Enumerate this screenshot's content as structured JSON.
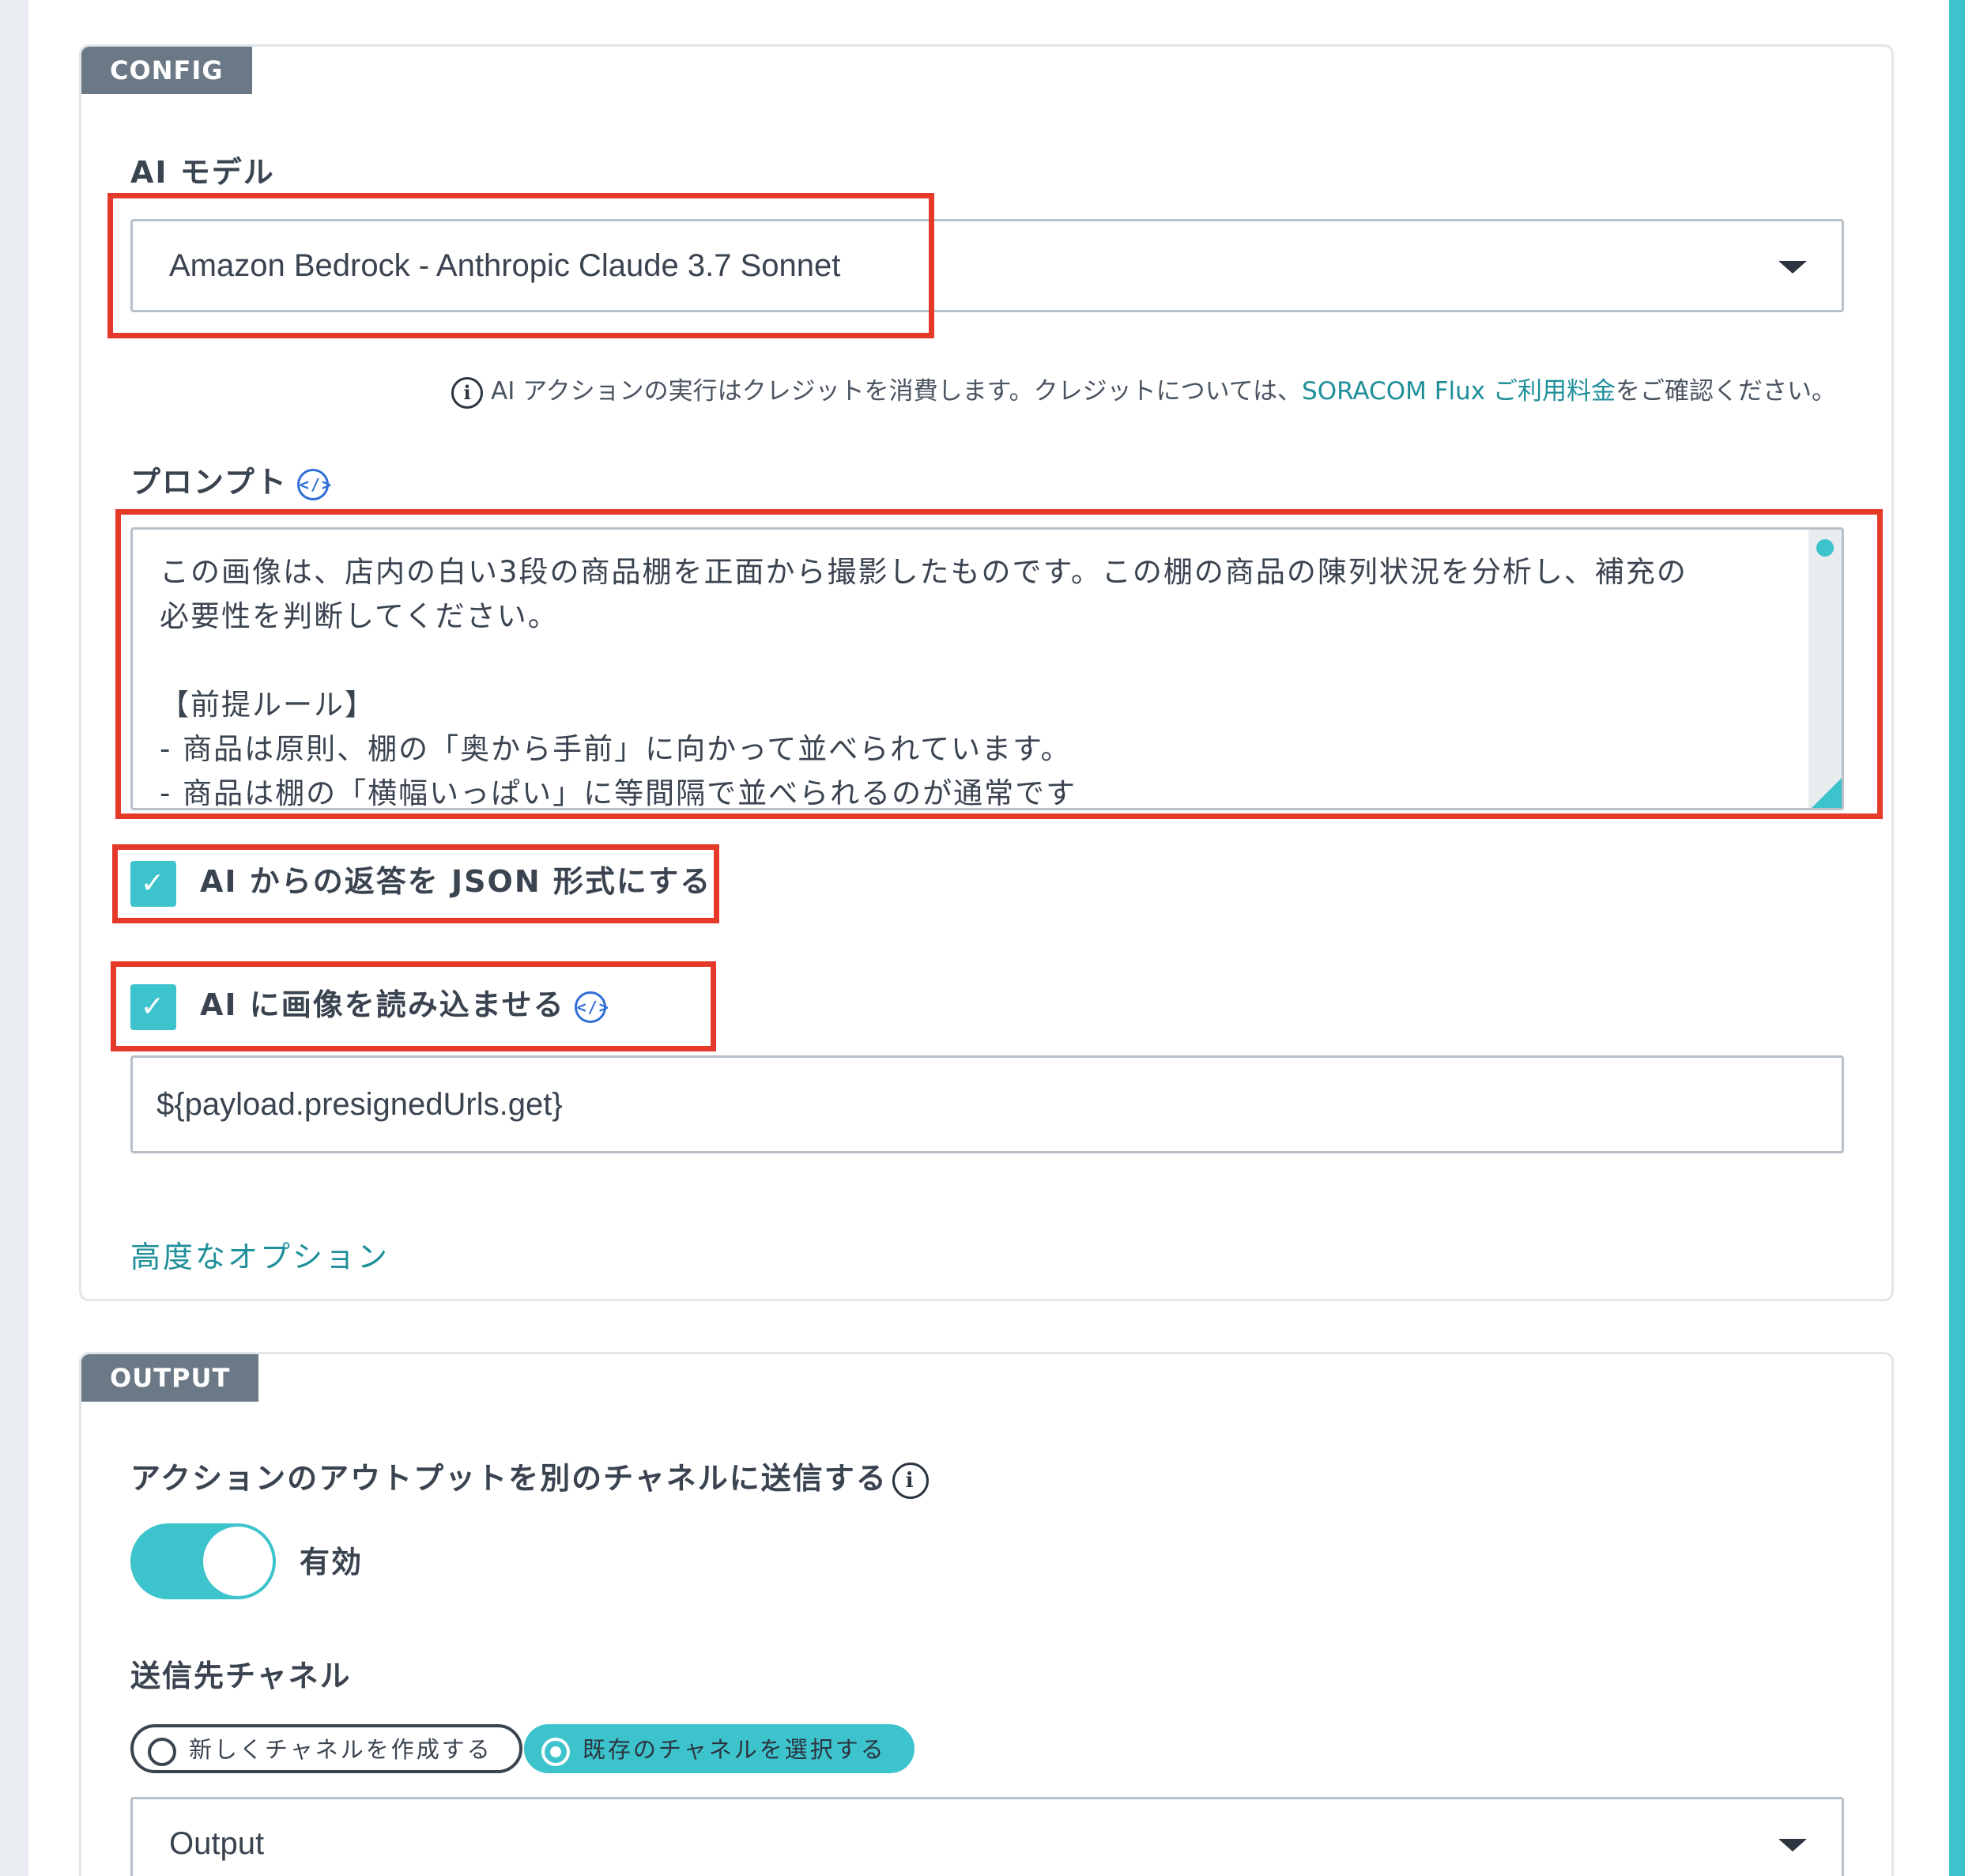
{
  "config": {
    "tag": "CONFIG",
    "ai_model": {
      "label": "AI モデル",
      "value": "Amazon Bedrock - Anthropic Claude 3.7 Sonnet"
    },
    "note": {
      "text_before": "AI アクションの実行はクレジットを消費します。クレジットについては、",
      "link": "SORACOM Flux ご利用料金",
      "text_after": "をご確認ください。"
    },
    "prompt": {
      "label": "プロンプト",
      "text": "この画像は、店内の白い3段の商品棚を正面から撮影したものです。この棚の商品の陳列状況を分析し、補充の\n必要性を判断してください。\n\n【前提ルール】\n- 商品は原則、棚の「奥から手前」に向かって並べられています。\n- 商品は棚の「横幅いっぱい」に等間隔で並べられるのが通常です"
    },
    "json_response": {
      "label": "AI からの返答を JSON 形式にする",
      "checked": true
    },
    "load_image": {
      "label": "AI に画像を読み込ませる",
      "checked": true,
      "value": "${payload.presignedUrls.get}"
    },
    "advanced_options": "高度なオプション"
  },
  "output": {
    "tag": "OUTPUT",
    "send_label": "アクションのアウトプットを別のチャネルに送信する",
    "toggle_label": "有効",
    "toggle_on": true,
    "channel_label": "送信先チャネル",
    "radio_new": "新しくチャネルを作成する",
    "radio_existing": "既存のチャネルを選択する",
    "selected_radio": "既存のチャネルを選択する",
    "channel_value": "Output"
  },
  "colors": {
    "accent": "#3cc3cc",
    "highlight": "#e53a2a",
    "link": "#1f8f9a",
    "tag_bg": "#6b7886"
  },
  "icons": {
    "info": "info-circle-icon",
    "code": "code-icon",
    "caret": "chevron-down-icon",
    "check": "check-icon"
  }
}
